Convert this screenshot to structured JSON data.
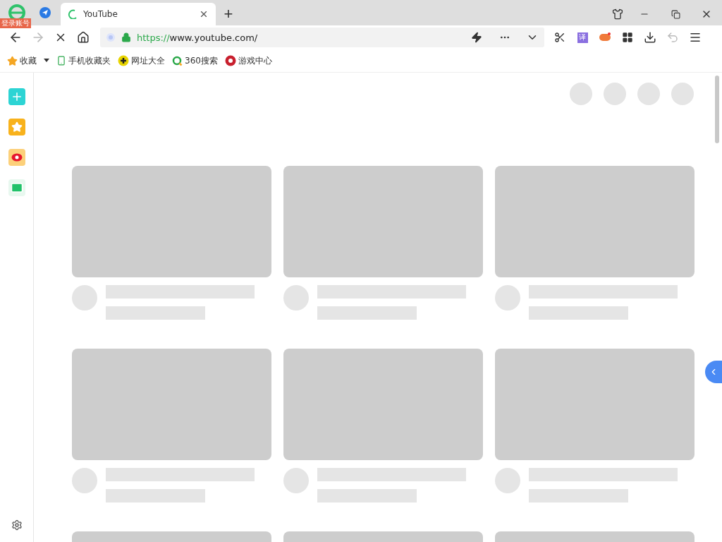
{
  "account_badge": "登录账号",
  "tabs": [
    {
      "kind": "pinned",
      "selected": false
    },
    {
      "kind": "page",
      "title": "YouTube",
      "selected": true,
      "loading": true
    }
  ],
  "new_tab": "+",
  "address_bar": {
    "scheme": "https://",
    "host": "www.youtube.com/"
  },
  "translate_icon": "译",
  "bookmarks": [
    {
      "label": "收藏",
      "kind": "star"
    },
    {
      "label": "手机收藏夹",
      "kind": "phone"
    },
    {
      "label": "网址大全",
      "kind": "plus"
    },
    {
      "label": "360搜索",
      "kind": "search"
    },
    {
      "label": "游戏中心",
      "kind": "game"
    }
  ],
  "sidebar": [
    {
      "kind": "clover"
    },
    {
      "kind": "star"
    },
    {
      "kind": "weibo"
    },
    {
      "kind": "mail"
    }
  ]
}
